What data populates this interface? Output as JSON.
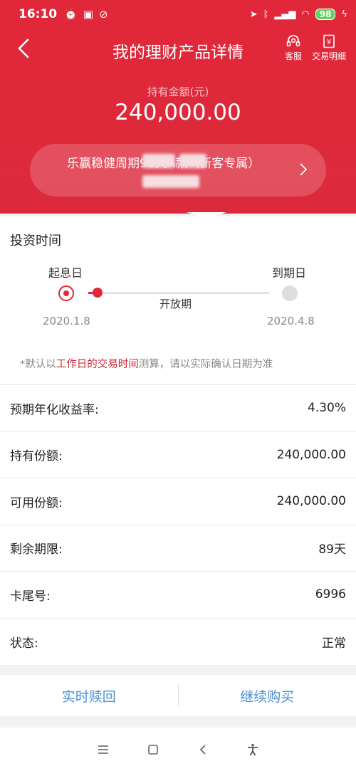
{
  "status_bar": {
    "time": "16:10",
    "battery": "98"
  },
  "nav": {
    "title": "我的理财产品详情",
    "customer_service_label": "客服",
    "transactions_label": "交易明细"
  },
  "holding": {
    "label": "持有金额(元)",
    "amount": "240,000.00"
  },
  "product": {
    "name": "乐赢稳健周期91天A款（新客专属）"
  },
  "invest_time": {
    "title": "投资时间",
    "start_label": "起息日",
    "end_label": "到期日",
    "start_date": "2020.1.8",
    "end_date": "2020.4.8",
    "period_label": "开放期",
    "progress": 0.05,
    "note_prefix": "*默认以",
    "note_highlight": "工作日的交易时间",
    "note_suffix": "测算，请以实际确认日期为准"
  },
  "details": [
    {
      "label": "预期年化收益率:",
      "value": "4.30%"
    },
    {
      "label": "持有份额:",
      "value": "240,000.00"
    },
    {
      "label": "可用份额:",
      "value": "240,000.00"
    },
    {
      "label": "剩余期限:",
      "value": "89天"
    },
    {
      "label": "卡尾号:",
      "value": "6996"
    },
    {
      "label": "状态:",
      "value": "正常"
    }
  ],
  "actions": {
    "redeem": "实时赎回",
    "buy_more": "继续购买"
  },
  "colors": {
    "brand_red": "#e0283a",
    "link_blue": "#4a8fd6"
  }
}
